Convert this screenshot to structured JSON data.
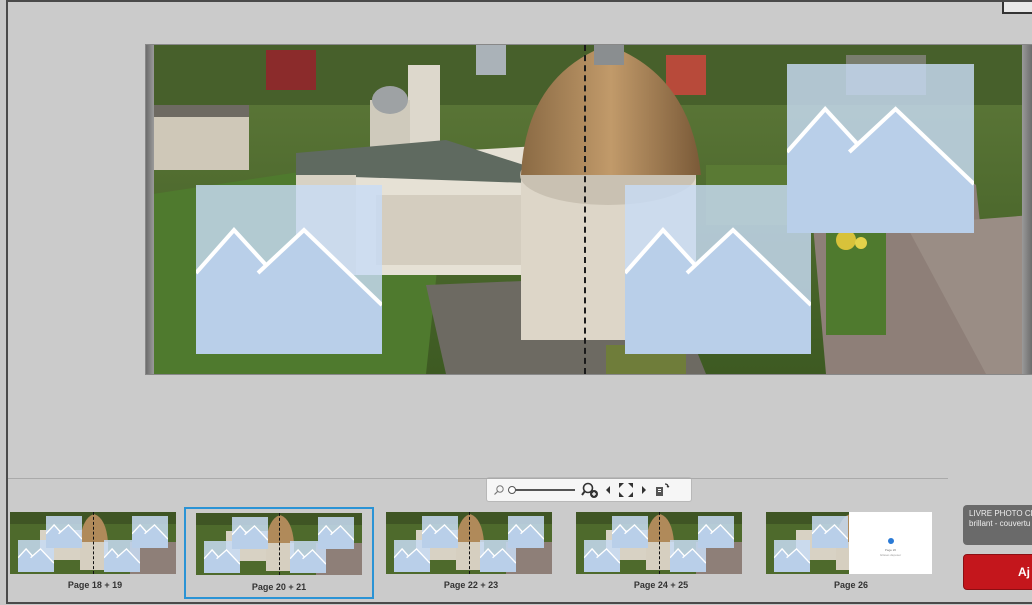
{
  "filmstrip": {
    "pages": [
      {
        "label": "Page 18 + 19",
        "selected": false,
        "type": "spread"
      },
      {
        "label": "Page 20 + 21",
        "selected": true,
        "type": "spread"
      },
      {
        "label": "Page 22 + 23",
        "selected": false,
        "type": "spread"
      },
      {
        "label": "Page 24 + 25",
        "selected": false,
        "type": "spread"
      },
      {
        "label": "Page 26",
        "selected": false,
        "type": "single"
      }
    ]
  },
  "product": {
    "line1": "LIVRE PHOTO CE",
    "line2": "brillant - couvertu"
  },
  "add_button_label": "Aj",
  "blank_page": {
    "line1": "Page 26",
    "line2": "Glisser-déposer"
  },
  "toolbar": {
    "icons": [
      "zoom-out-icon",
      "zoom-in-icon",
      "previous-icon",
      "fullscreen-icon",
      "next-icon",
      "page-options-icon"
    ]
  },
  "colors": {
    "selection": "#2a93d5",
    "add_button": "#c4161c",
    "placeholder": "#c8dcf5"
  }
}
